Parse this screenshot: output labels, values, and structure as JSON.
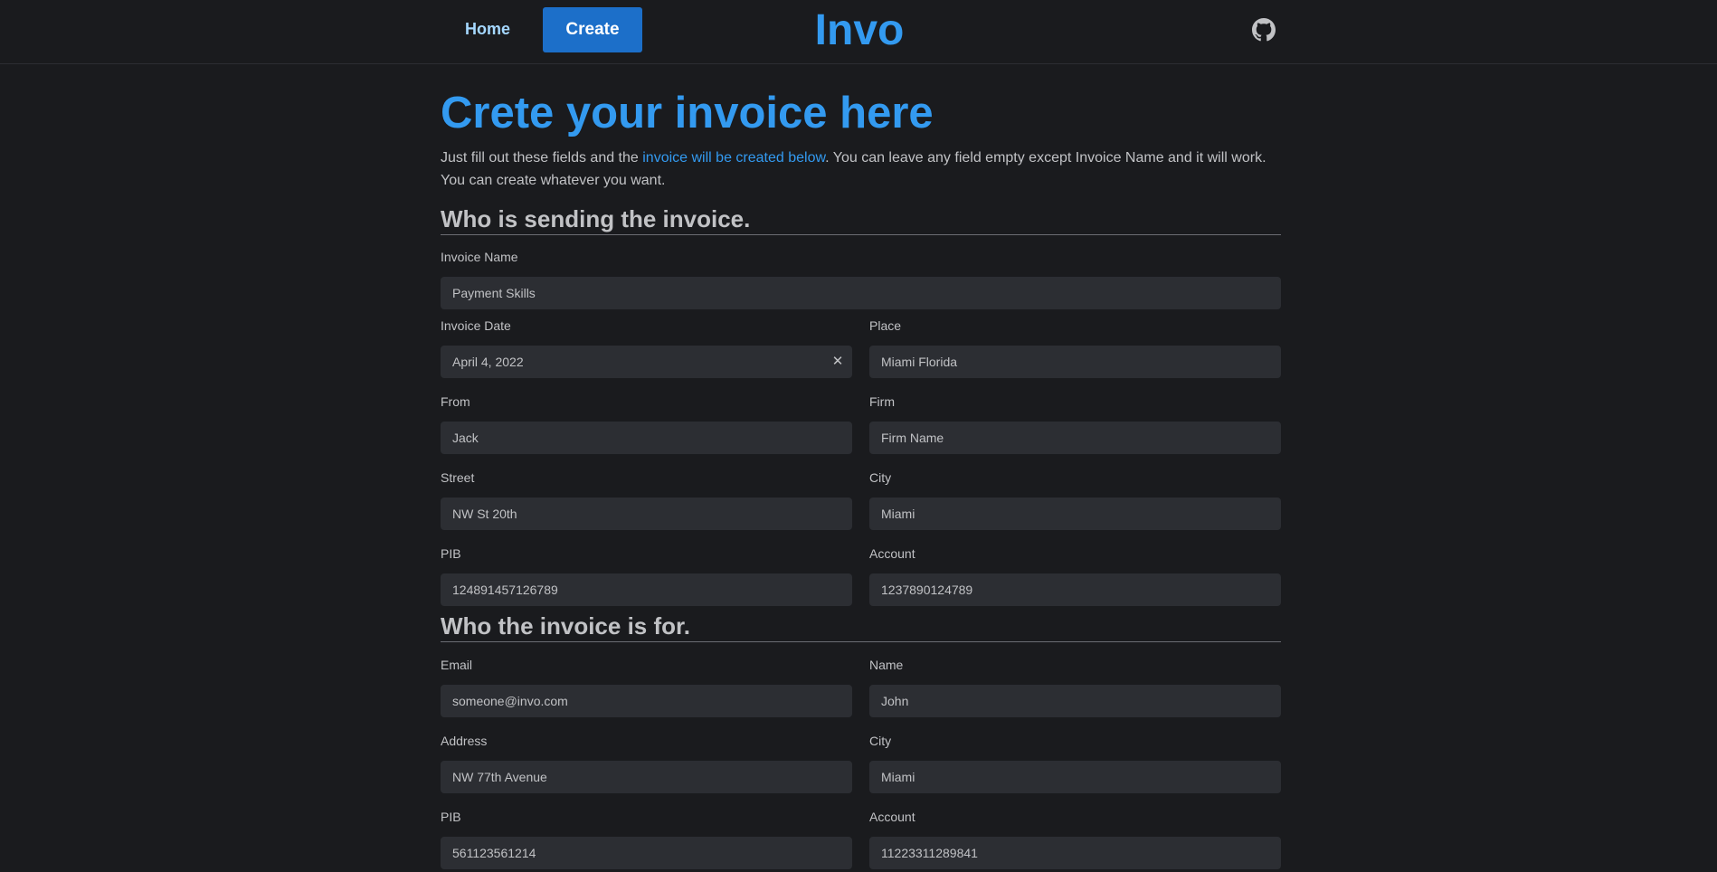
{
  "header": {
    "home_label": "Home",
    "create_label": "Create",
    "logo": "Invo",
    "github_icon": "github-icon"
  },
  "page": {
    "title": "Crete your invoice here",
    "intro_before": "Just fill out these fields and the ",
    "intro_link": "invoice will be created below",
    "intro_after": ". You can leave any field empty except Invoice Name and it will work. You can create whatever you want."
  },
  "sender": {
    "section_title": "Who is sending the invoice.",
    "invoice_name": {
      "label": "Invoice Name",
      "value": "Payment Skills"
    },
    "invoice_date": {
      "label": "Invoice Date",
      "value": "April 4, 2022"
    },
    "place": {
      "label": "Place",
      "value": "Miami Florida"
    },
    "from": {
      "label": "From",
      "value": "Jack"
    },
    "firm": {
      "label": "Firm",
      "value": "Firm Name"
    },
    "street": {
      "label": "Street",
      "value": "NW St 20th"
    },
    "city": {
      "label": "City",
      "value": "Miami"
    },
    "pib": {
      "label": "PIB",
      "value": "124891457126789"
    },
    "account": {
      "label": "Account",
      "value": "1237890124789"
    }
  },
  "recipient": {
    "section_title": "Who the invoice is for.",
    "email": {
      "label": "Email",
      "value": "someone@invo.com"
    },
    "name": {
      "label": "Name",
      "value": "John"
    },
    "address": {
      "label": "Address",
      "value": "NW 77th Avenue"
    },
    "city": {
      "label": "City",
      "value": "Miami"
    },
    "pib": {
      "label": "PIB",
      "value": "561123561214"
    },
    "account": {
      "label": "Account",
      "value": "11223311289841"
    }
  },
  "colors": {
    "background": "#1a1b1e",
    "accent": "#339af0",
    "button": "#1c6fc9",
    "input_bg": "#2c2e33",
    "text": "#c1c2c5"
  }
}
